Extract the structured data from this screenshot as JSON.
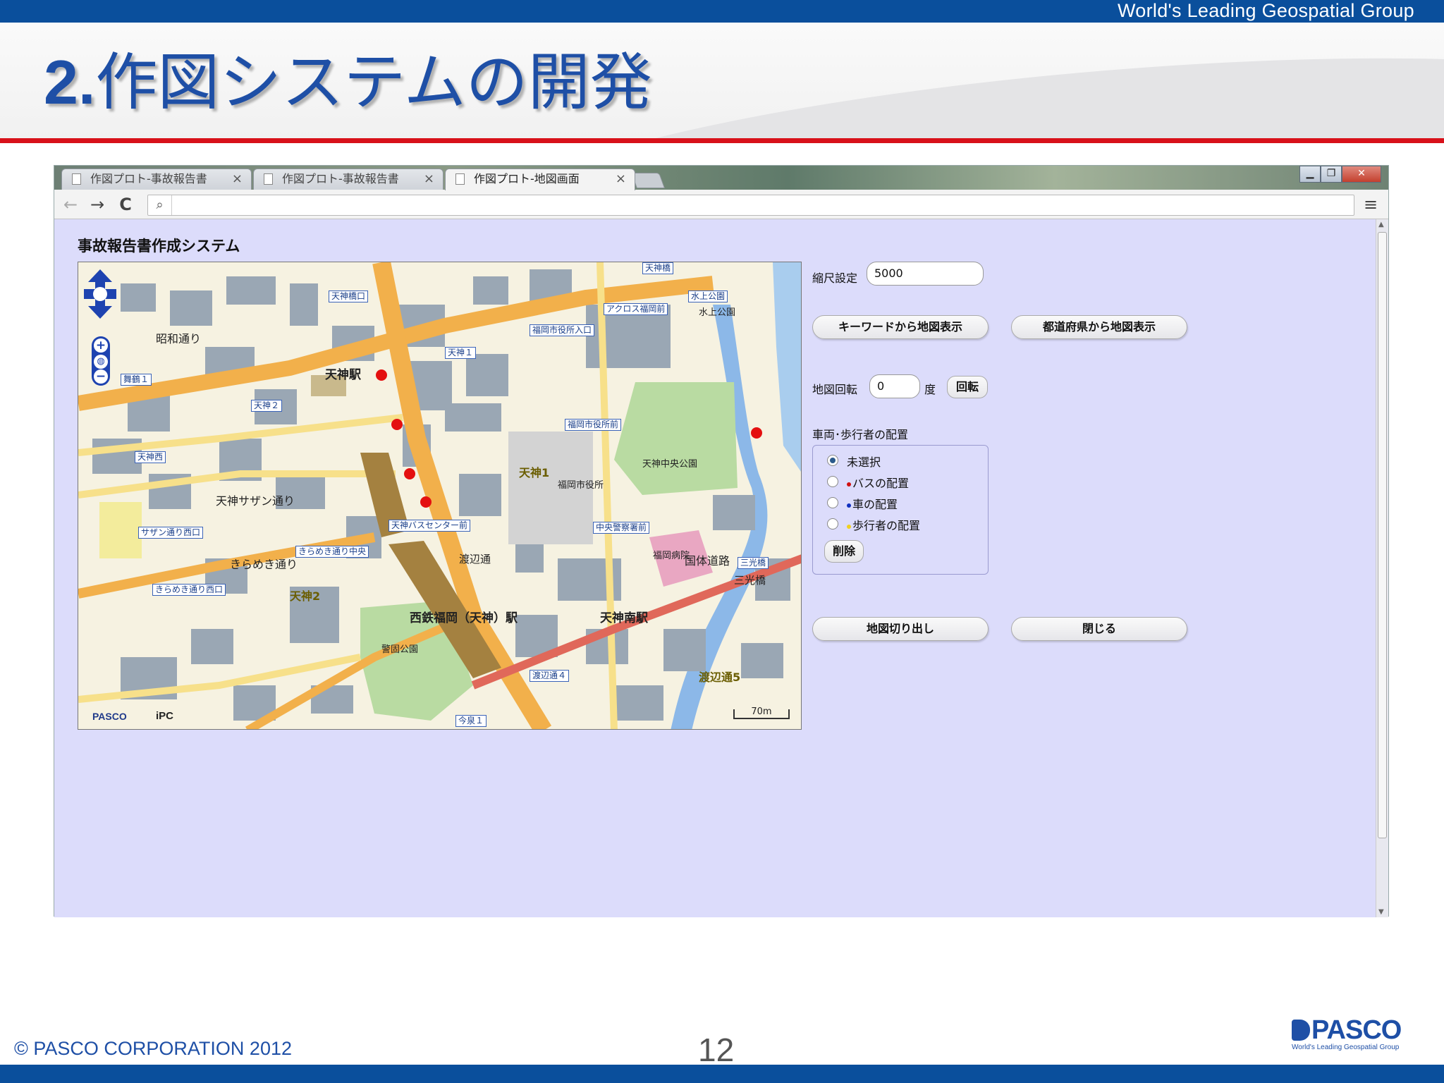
{
  "slide": {
    "tagline": "World's Leading Geospatial Group",
    "title_number": "2.",
    "title_text": "作図システムの開発",
    "copyright": "© PASCO CORPORATION 2012",
    "page_number": "12",
    "logo_word": "PASCO",
    "logo_sub": "World's Leading Geospatial Group",
    "colors": {
      "brand_blue": "#0a4f9c",
      "accent_red": "#d8111a",
      "page_bg": "#dcdcfb"
    }
  },
  "browser": {
    "tabs": [
      {
        "label": "作図プロト-事故報告書",
        "active": false
      },
      {
        "label": "作図プロト-事故報告書",
        "active": false
      },
      {
        "label": "作図プロト-地図画面",
        "active": true
      }
    ],
    "tab_close": "×",
    "nav": {
      "back": "←",
      "forward": "→",
      "reload": "C",
      "menu": "≡"
    },
    "address": ""
  },
  "app": {
    "title": "事故報告書作成システム",
    "scale_label": "縮尺設定",
    "scale_value": "5000",
    "keyword_button": "キーワードから地図表示",
    "prefecture_button": "都道府県から地図表示",
    "rotation_label": "地図回転",
    "rotation_value": "0",
    "rotation_unit": "度",
    "rotate_button": "回転",
    "placement_label": "車両･歩行者の配置",
    "radio_options": [
      {
        "label": "未選択",
        "checked": true,
        "dot_color": ""
      },
      {
        "label": "バスの配置",
        "checked": false,
        "dot_color": "#d01010"
      },
      {
        "label": "車の配置",
        "checked": false,
        "dot_color": "#1030c0"
      },
      {
        "label": "歩行者の配置",
        "checked": false,
        "dot_color": "#f0d020"
      }
    ],
    "delete_button": "削除",
    "cut_map_button": "地図切り出し",
    "close_button": "閉じる"
  },
  "map": {
    "labels": {
      "tenjin_station": "天神駅",
      "tenjin_minami": "天神南駅",
      "nishitetsu": "西鉄福岡（天神）駅",
      "tenjin1": "天神1",
      "tenjin2": "天神2",
      "watanabe5": "渡辺通5",
      "showa": "昭和通り",
      "tenjin_chuo": "天神中央公園",
      "fukuoka_city": "福岡市役所",
      "keigo": "警固公園",
      "sanko": "三光橋",
      "kokutai": "国体道路",
      "watanabe_dori": "渡辺通",
      "kirameki": "きらめき通り",
      "sazan": "天神サザン通り",
      "mizukami": "水上公園",
      "fukuoka_hospital": "福岡病院"
    },
    "stops": {
      "tenjin_kitaguchi": "天神橋口",
      "acros": "アクロス福岡前",
      "shiyakusho_iriguchi": "福岡市役所入口",
      "tenjin1_stop": "天神１",
      "maizuru": "舞鶴１",
      "tenjin2_stop": "天神２",
      "tenjinnishi": "天神西",
      "shiyakusho_mae": "福岡市役所前",
      "bus_center": "天神バスセンター前",
      "sazan_nishi": "サザン通り西口",
      "kirameki_chuo": "きらめき通り中央",
      "kirameki_nishi": "きらめき通り西口",
      "chuo_police": "中央警察署前",
      "watanabe4": "渡辺通４",
      "imaizumi": "今泉１",
      "tenjinbashi": "天神橋",
      "mizukami_stop": "水上公園",
      "sanko_stop": "三光橋"
    },
    "logo": "PASCO",
    "logo2": "iPC",
    "scale_bar": "70m",
    "bus_markers_count": 5
  }
}
